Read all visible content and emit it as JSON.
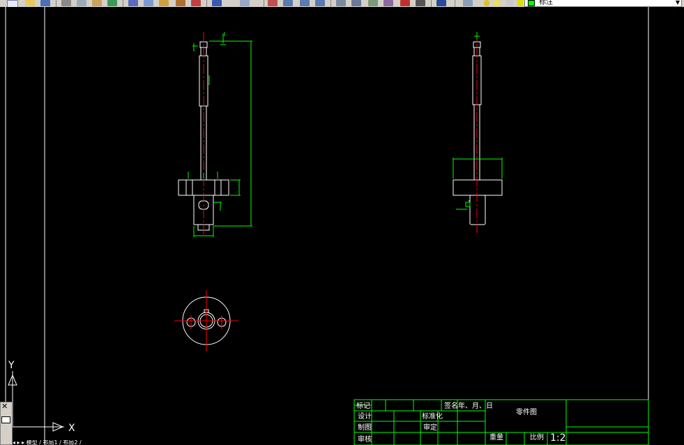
{
  "toolbar": {
    "layer_combo": {
      "value": "标注"
    },
    "icons": [
      "new-icon",
      "open-icon",
      "save-icon",
      "print-icon",
      "plot-preview-icon",
      "publish-icon",
      "3d-dwf-icon",
      "cut-icon",
      "copy-icon",
      "paste-icon",
      "match-properties-icon",
      "block-editor-icon",
      "undo-icon",
      "redo-icon",
      "pan-icon",
      "zoom-realtime-icon",
      "zoom-window-icon",
      "zoom-previous-icon",
      "properties-icon",
      "design-center-icon",
      "tool-palettes-icon",
      "sheet-set-icon",
      "markup-icon",
      "calculator-icon",
      "help-icon",
      "layer-manager-icon"
    ]
  },
  "ucs": {
    "y_label": "Y",
    "x_label": "X"
  },
  "title_block": {
    "row1": {
      "mark": "标记",
      "sign": "签名",
      "date": "年、月、日"
    },
    "design": "设计",
    "standardization": "标准化",
    "drafting": "制图",
    "review1": "审定",
    "review2": "审核",
    "part_title": "零件图",
    "weight_label": "重量",
    "scale_label": "比例",
    "scale_value": "1:2"
  },
  "bottom_tabs": "◂ ▸ ▸ 模型 / 布局1 / 布局2 /",
  "colors": {
    "background": "#000000",
    "green": "#00ff00",
    "red": "#ff0000",
    "white": "#ffffff",
    "toolbar": "#d4d0c8"
  }
}
